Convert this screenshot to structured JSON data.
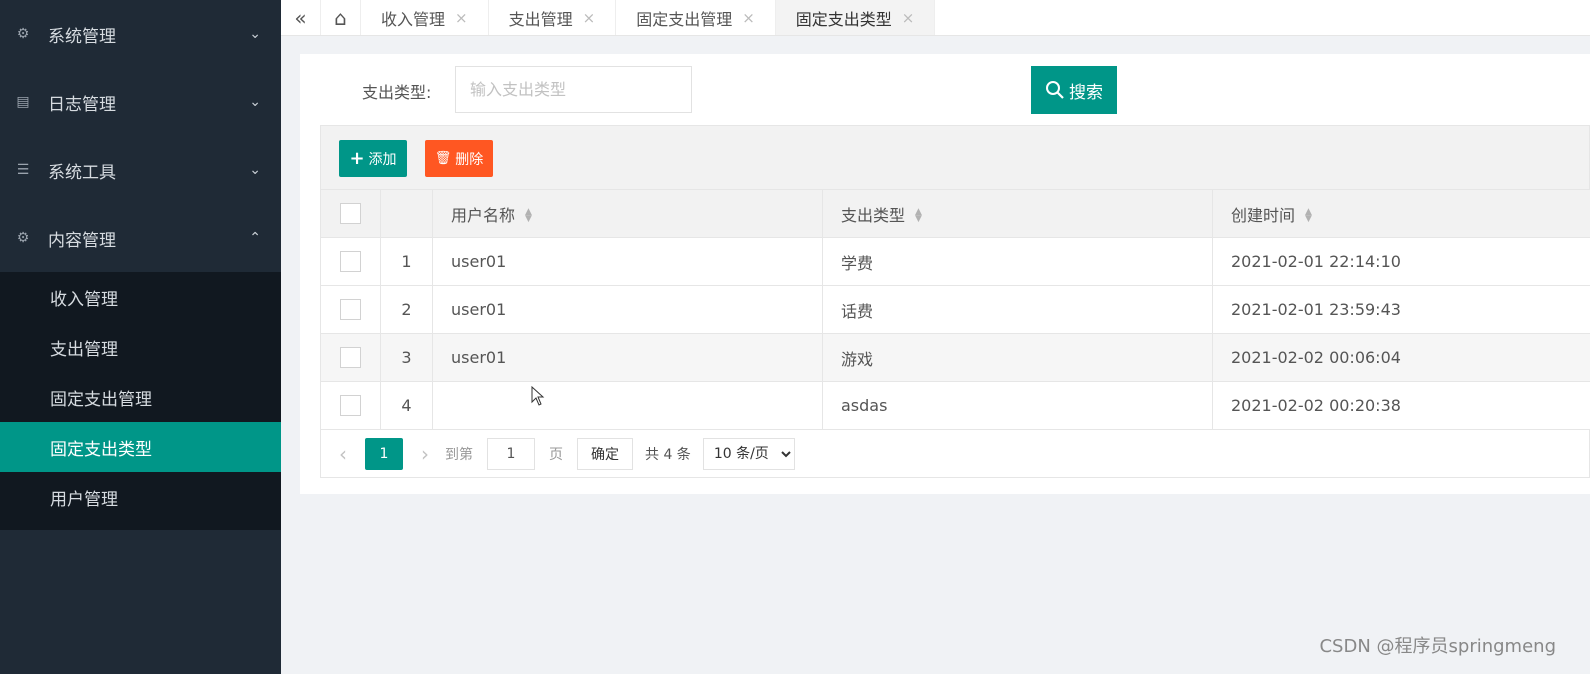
{
  "sidebar": {
    "groups": [
      {
        "label": "系统管理",
        "icon": "gear-icon"
      },
      {
        "label": "日志管理",
        "icon": "document-icon"
      },
      {
        "label": "系统工具",
        "icon": "sliders-icon"
      },
      {
        "label": "内容管理",
        "icon": "gear-icon"
      }
    ],
    "subitems": [
      "收入管理",
      "支出管理",
      "固定支出管理",
      "固定支出类型",
      "用户管理"
    ]
  },
  "tabs": [
    {
      "label": "收入管理"
    },
    {
      "label": "支出管理"
    },
    {
      "label": "固定支出管理"
    },
    {
      "label": "固定支出类型"
    }
  ],
  "search": {
    "label": "支出类型:",
    "placeholder": "输入支出类型",
    "button": "搜索"
  },
  "toolbar": {
    "add_label": "添加",
    "delete_label": "删除"
  },
  "table": {
    "columns": [
      "用户名称",
      "支出类型",
      "创建时间"
    ],
    "rows": [
      {
        "num": "1",
        "user": "user01",
        "type": "学费",
        "created": "2021-02-01 22:14:10"
      },
      {
        "num": "2",
        "user": "user01",
        "type": "话费",
        "created": "2021-02-01 23:59:43"
      },
      {
        "num": "3",
        "user": "user01",
        "type": "游戏",
        "created": "2021-02-02 00:06:04"
      },
      {
        "num": "4",
        "user": "",
        "type": "asdas",
        "created": "2021-02-02 00:20:38"
      }
    ]
  },
  "pager": {
    "current": "1",
    "skip_label": "到第",
    "page_value": "1",
    "page_unit": "页",
    "confirm": "确定",
    "total": "共 4 条",
    "limit": "10 条/页"
  },
  "watermark": "CSDN @程序员springmeng",
  "colors": {
    "accent": "#009688",
    "danger": "#ff5722",
    "sidebar": "#1f2a36"
  }
}
